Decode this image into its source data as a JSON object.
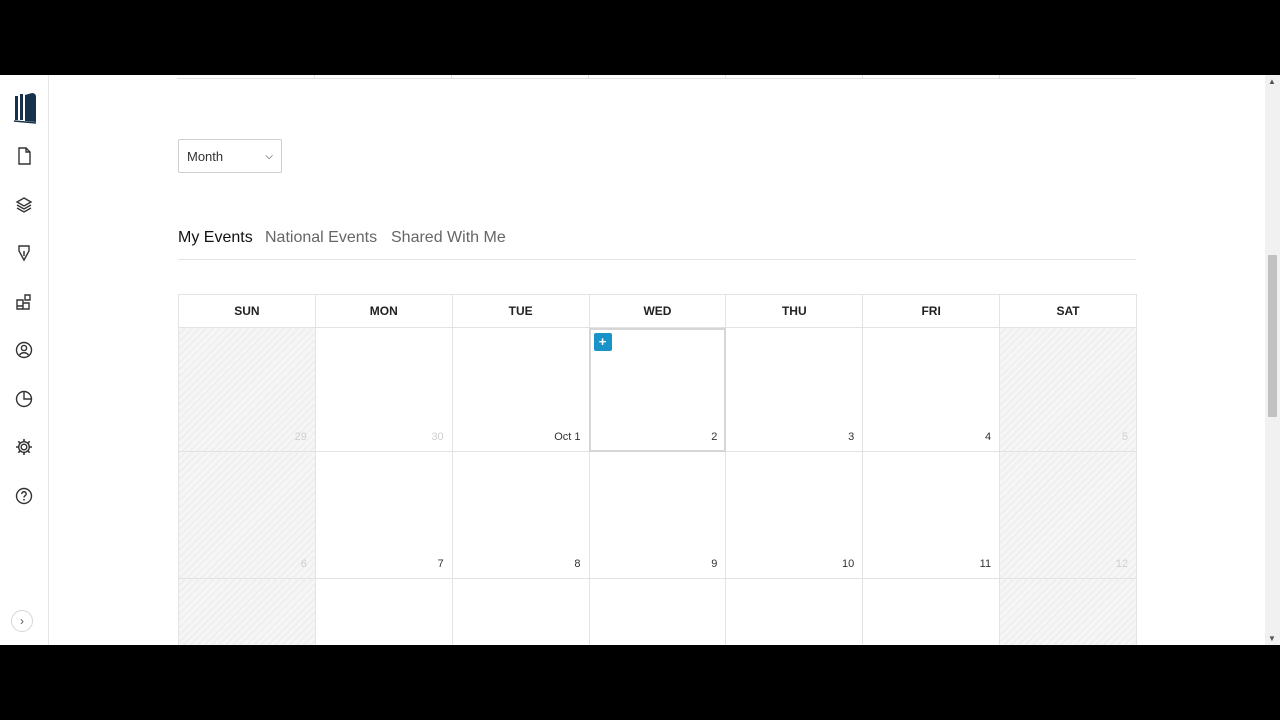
{
  "sidebar": {
    "icons": [
      "logo-book-icon",
      "document-icon",
      "layers-icon",
      "pen-icon",
      "widgets-icon",
      "user-circle-icon",
      "pie-chart-icon",
      "gear-icon",
      "help-icon"
    ],
    "collapse_glyph": "›"
  },
  "view_select": {
    "value": "Month"
  },
  "tabs": [
    {
      "label": "My Events",
      "active": true
    },
    {
      "label": "National Events",
      "active": false
    },
    {
      "label": "Shared With Me",
      "active": false
    }
  ],
  "calendar": {
    "weekdays": [
      "SUN",
      "MON",
      "TUE",
      "WED",
      "THU",
      "FRI",
      "SAT"
    ],
    "weeks": [
      [
        "29",
        "30",
        "Oct 1",
        "2",
        "3",
        "4",
        "5"
      ],
      [
        "6",
        "7",
        "8",
        "9",
        "10",
        "11",
        "12"
      ],
      [
        "",
        "",
        "",
        "",
        "",
        "",
        ""
      ]
    ],
    "add_glyph": "+",
    "accent": "#1a93c8"
  }
}
